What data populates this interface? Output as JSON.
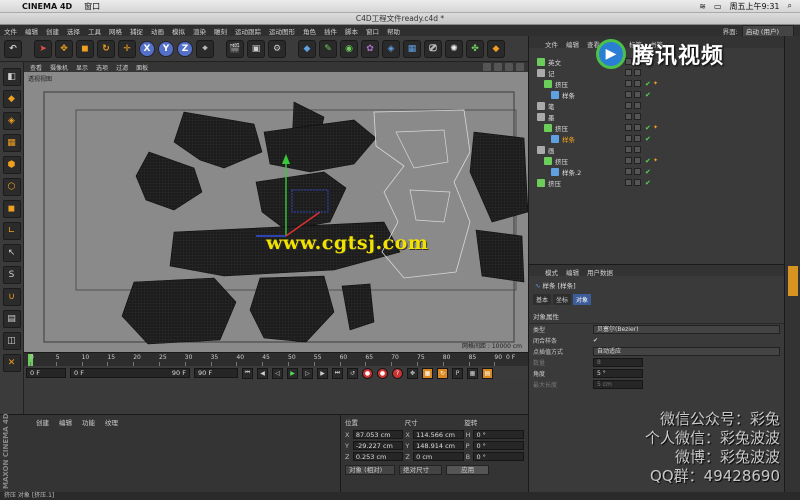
{
  "os_bar": {
    "app": "CINEMA 4D",
    "menu_window": "窗口",
    "datetime": "周五上午9:31"
  },
  "window_title": "C4D工程文件ready.c4d *",
  "menu": [
    "文件",
    "编辑",
    "创建",
    "选择",
    "工具",
    "网格",
    "捕捉",
    "动画",
    "模拟",
    "渲染",
    "雕刻",
    "运动跟踪",
    "运动图形",
    "角色",
    "插件",
    "脚本",
    "窗口",
    "帮助"
  ],
  "layout": {
    "label": "界面:",
    "value": "启动 (用户)"
  },
  "toolbar": {
    "axis_x": "X",
    "axis_y": "Y",
    "axis_z": "Z"
  },
  "viewport": {
    "menu": [
      "查看",
      "摄像机",
      "显示",
      "选项",
      "过滤",
      "面板"
    ],
    "camera_label": "透视视图",
    "grid_info": "网格间距 : 10000 cm",
    "watermark": "www.cgtsj.com"
  },
  "timeline": {
    "ticks": [
      "0",
      "5",
      "10",
      "15",
      "20",
      "25",
      "30",
      "35",
      "40",
      "45",
      "50",
      "55",
      "60",
      "65",
      "70",
      "75",
      "80",
      "85",
      "90"
    ],
    "frame_end_label": "0 F",
    "start": "0 F",
    "current": "0 F",
    "range_end": "90 F",
    "end": "90 F"
  },
  "material": {
    "menu": [
      "创建",
      "编辑",
      "功能",
      "纹理"
    ],
    "brand": "MAXON CINEMA 4D"
  },
  "coords": {
    "headers": [
      "位置",
      "尺寸",
      "旋转"
    ],
    "rows": [
      {
        "ax": "X",
        "pos": "87.053 cm",
        "sax": "X",
        "size": "114.566 cm",
        "rax": "H",
        "rot": "0 °"
      },
      {
        "ax": "Y",
        "pos": "-29.227 cm",
        "sax": "Y",
        "size": "148.914 cm",
        "rax": "P",
        "rot": "0 °"
      },
      {
        "ax": "Z",
        "pos": "0.253 cm",
        "sax": "Z",
        "size": "0 cm",
        "rax": "B",
        "rot": "0 °"
      }
    ],
    "mode": "对象 (相对)",
    "size_mode": "绝对尺寸",
    "apply": "应用"
  },
  "statusbar": "挤压 对象 [挤压.1]",
  "object_manager": {
    "menu": [
      "文件",
      "编辑",
      "查看",
      "对象",
      "标签",
      "书签"
    ],
    "items": [
      {
        "name": "英文",
        "indent": 0,
        "color": "#6cce5a",
        "tick": true,
        "tag": false,
        "hl": false
      },
      {
        "name": "记",
        "indent": 0,
        "color": "#aaaaaa",
        "tick": false,
        "tag": false,
        "hl": false
      },
      {
        "name": "挤压",
        "indent": 1,
        "color": "#6cce5a",
        "tick": true,
        "tag": true,
        "hl": false
      },
      {
        "name": "样条",
        "indent": 2,
        "color": "#5fa0e0",
        "tick": true,
        "tag": false,
        "hl": false
      },
      {
        "name": "笔",
        "indent": 0,
        "color": "#aaaaaa",
        "tick": false,
        "tag": false,
        "hl": false
      },
      {
        "name": "墨",
        "indent": 0,
        "color": "#aaaaaa",
        "tick": false,
        "tag": false,
        "hl": false
      },
      {
        "name": "挤压",
        "indent": 1,
        "color": "#6cce5a",
        "tick": true,
        "tag": true,
        "hl": false
      },
      {
        "name": "样条",
        "indent": 2,
        "color": "#5fa0e0",
        "tick": true,
        "tag": false,
        "hl": true
      },
      {
        "name": "画",
        "indent": 0,
        "color": "#aaaaaa",
        "tick": false,
        "tag": false,
        "hl": false
      },
      {
        "name": "挤压",
        "indent": 1,
        "color": "#6cce5a",
        "tick": true,
        "tag": true,
        "hl": false
      },
      {
        "name": "样条.2",
        "indent": 2,
        "color": "#5fa0e0",
        "tick": true,
        "tag": false,
        "hl": false
      },
      {
        "name": "挤压",
        "indent": 0,
        "color": "#6cce5a",
        "tick": true,
        "tag": false,
        "hl": false
      }
    ]
  },
  "attributes": {
    "menu": [
      "模式",
      "编辑",
      "用户数据"
    ],
    "title": "样条 [样条]",
    "tabs": [
      "基本",
      "坐标",
      "对象"
    ],
    "section": "对象属性",
    "rows": [
      {
        "label": "类型",
        "value": "贝塞尔(Bezier)",
        "kind": "dropdown"
      },
      {
        "label": "闭合样条",
        "value": "✔",
        "kind": "check"
      },
      {
        "label": "点插值方式",
        "value": "自动适应",
        "kind": "dropdown"
      },
      {
        "label": "数量",
        "value": "8",
        "kind": "small",
        "dim": true
      },
      {
        "label": "角度",
        "value": "5 °",
        "kind": "small",
        "dim": false
      },
      {
        "label": "最大长度",
        "value": "5 cm",
        "kind": "small",
        "dim": true
      }
    ]
  },
  "overlay": {
    "brand": "腾讯视频",
    "wechat_lines": [
      "微信公众号：彩兔",
      "个人微信：彩兔波波",
      "微博：彩兔波波",
      "QQ群：49428690"
    ]
  }
}
